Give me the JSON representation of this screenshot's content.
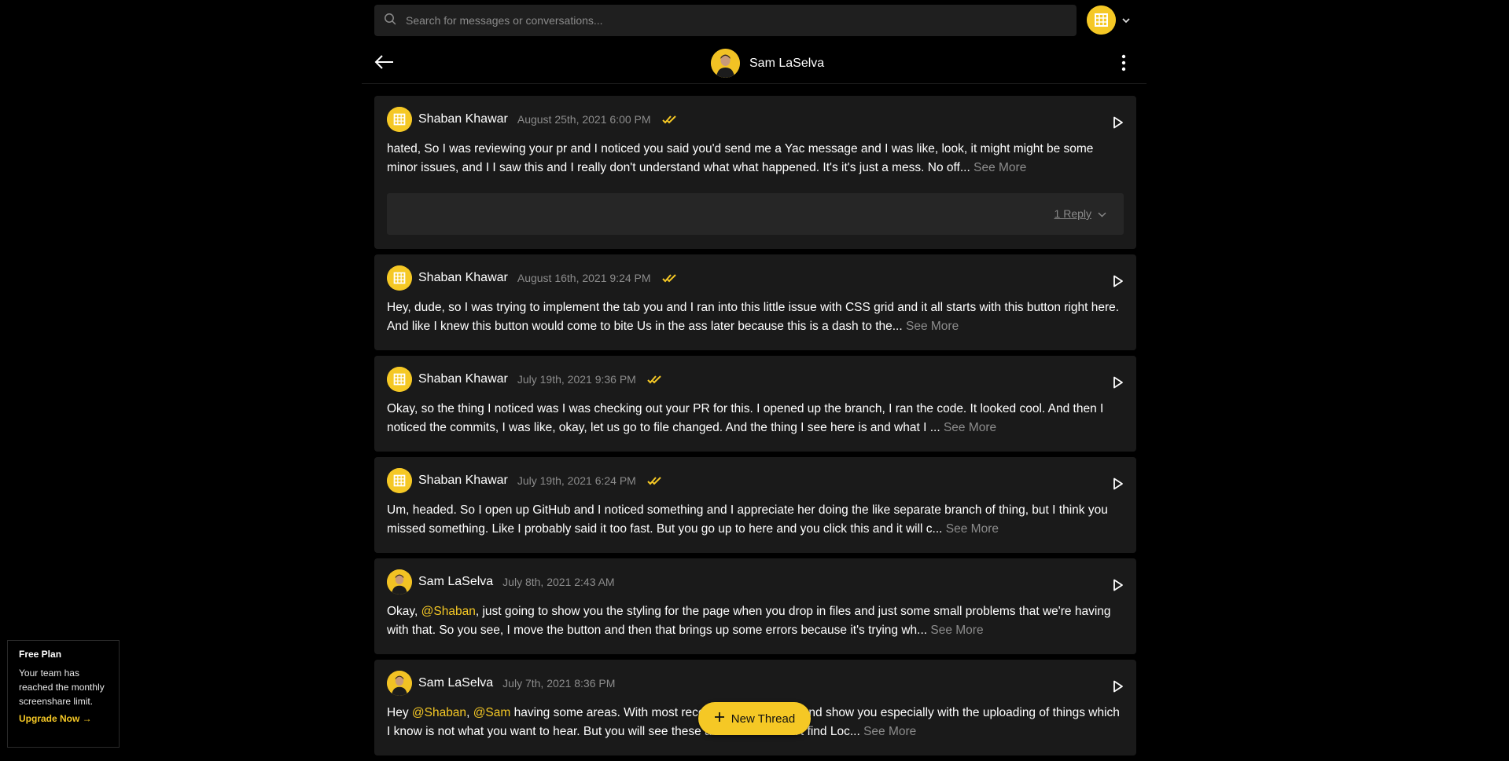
{
  "search": {
    "placeholder": "Search for messages or conversations..."
  },
  "header": {
    "title": "Sam LaSelva"
  },
  "messages": [
    {
      "sender": "Shaban Khawar",
      "time": "August 25th, 2021 6:00 PM",
      "read": true,
      "text": "hated, So I was reviewing your pr and I noticed you said you'd send me a Yac message and I was like, look, it might might be some minor issues, and I I saw this and I really don't understand what what happened. It's it's just a mess. No off...",
      "see_more": "See More",
      "reply_label": "1 Reply"
    },
    {
      "sender": "Shaban Khawar",
      "time": "August 16th, 2021 9:24 PM",
      "read": true,
      "text": "Hey, dude, so I was trying to implement the tab you and I ran into this little issue with CSS grid and it all starts with this button right here. And like I knew this button would come to bite Us in the ass later because this is a dash to the...",
      "see_more": "See More"
    },
    {
      "sender": "Shaban Khawar",
      "time": "July 19th, 2021 9:36 PM",
      "read": true,
      "text": "Okay, so the thing I noticed was I was checking out your PR for this. I opened up the branch, I ran the code. It looked cool. And then I noticed the commits, I was like, okay, let us go to file changed. And the thing I see here is and what I ...",
      "see_more": "See More"
    },
    {
      "sender": "Shaban Khawar",
      "time": "July 19th, 2021 6:24 PM",
      "read": true,
      "text": "Um, headed. So I open up GitHub and I noticed something and I appreciate her doing the like separate branch of thing, but I think you missed something. Like I probably said it too fast. But you go up to here and you click this and it will c...",
      "see_more": "See More"
    },
    {
      "sender": "Sam LaSelva",
      "time": "July 8th, 2021 2:43 AM",
      "read": false,
      "text_before": "Okay, ",
      "mention1": "@Shaban",
      "text_after": ", just going to show you the styling for the page when you drop in files and just some small problems that we're having with that. So you see, I move the button and then that brings up some errors because it's trying wh...",
      "see_more": "See More"
    },
    {
      "sender": "Sam LaSelva",
      "time": "July 7th, 2021 8:36 PM",
      "read": false,
      "text_before": "Hey ",
      "mention1": "@Shaban",
      "sep": ", ",
      "mention2": "@Sam",
      "text_after": " having some areas. With most recent build go ahead and show you especially with the uploading of things which I know is not what you want to hear. But you will see these arrows here. Can't find Loc...",
      "see_more": "See More"
    }
  ],
  "new_thread": {
    "label": "New Thread"
  },
  "plan": {
    "title": "Free Plan",
    "text": "Your team has reached the monthly screenshare limit.",
    "link": "Upgrade Now →"
  },
  "colors": {
    "accent": "#f5c825",
    "background": "#000000",
    "card": "#1a1a1a",
    "muted": "#8c8c8c"
  },
  "icons": [
    "search-icon",
    "chevron-down-icon",
    "back-arrow-icon",
    "more-vertical-icon",
    "double-check-icon",
    "play-icon",
    "plus-icon"
  ]
}
